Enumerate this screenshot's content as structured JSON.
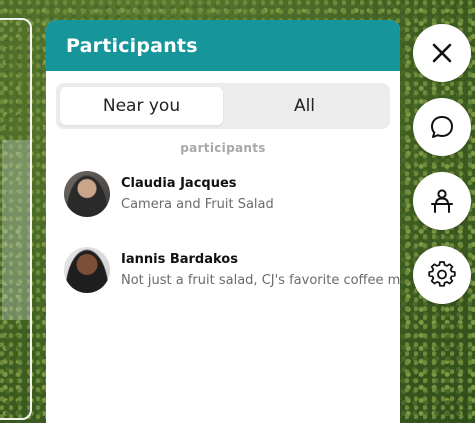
{
  "panel": {
    "title": "Participants",
    "tabs": [
      {
        "label": "Near you",
        "active": true
      },
      {
        "label": "All",
        "active": false
      }
    ],
    "section_label": "participants",
    "participants": [
      {
        "name": "Claudia Jacques",
        "status": "Camera and Fruit Salad",
        "avatar": "person-avatar"
      },
      {
        "name": "Iannis Bardakos",
        "status": "Not just a fruit salad, CJ's favorite coffee m",
        "avatar": "person-avatar"
      }
    ]
  },
  "side_buttons": [
    {
      "icon": "close-icon"
    },
    {
      "icon": "chat-bubble-icon"
    },
    {
      "icon": "person-at-desk-icon"
    },
    {
      "icon": "gear-icon"
    }
  ],
  "colors": {
    "header": "#16969b",
    "panel_bg": "#ffffff",
    "tab_track": "#ececec"
  }
}
